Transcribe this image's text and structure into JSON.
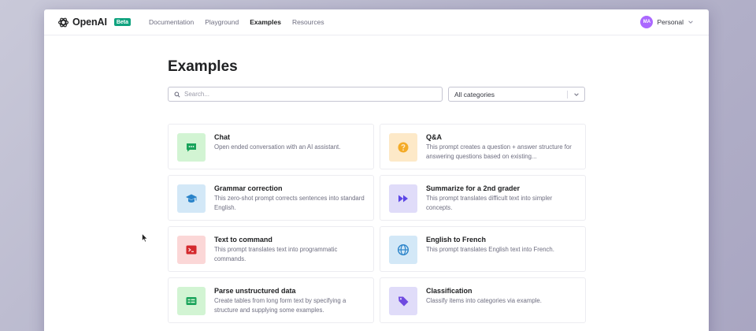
{
  "brand": {
    "name": "OpenAI",
    "badge": "Beta"
  },
  "nav": {
    "links": [
      {
        "label": "Documentation",
        "active": false
      },
      {
        "label": "Playground",
        "active": false
      },
      {
        "label": "Examples",
        "active": true
      },
      {
        "label": "Resources",
        "active": false
      }
    ]
  },
  "account": {
    "initials": "MA",
    "name": "Personal",
    "avatar_color": "#ab68ff"
  },
  "page": {
    "title": "Examples"
  },
  "search": {
    "placeholder": "Search...",
    "value": "",
    "icon": "search-icon"
  },
  "category_select": {
    "selected": "All categories",
    "icon": "chevron-down-icon"
  },
  "examples": [
    {
      "title": "Chat",
      "description": "Open ended conversation with an AI assistant.",
      "icon": "chat-icon",
      "bg": "#d2f4d3",
      "fg": "#19a35a"
    },
    {
      "title": "Q&A",
      "description": "This prompt creates a question + answer structure for answering questions based on existing...",
      "icon": "question-icon",
      "bg": "#fde9c8",
      "fg": "#f4ab27"
    },
    {
      "title": "Grammar correction",
      "description": "This zero-shot prompt corrects sentences into standard English.",
      "icon": "graduation-cap-icon",
      "bg": "#d3e8f7",
      "fg": "#2a83c9"
    },
    {
      "title": "Summarize for a 2nd grader",
      "description": "This prompt translates difficult text into simpler concepts.",
      "icon": "fast-forward-icon",
      "bg": "#e0dcf9",
      "fg": "#5c46e6"
    },
    {
      "title": "Text to command",
      "description": "This prompt translates text into programmatic commands.",
      "icon": "terminal-icon",
      "bg": "#fbd7d7",
      "fg": "#d4292d"
    },
    {
      "title": "English to French",
      "description": "This prompt translates English text into French.",
      "icon": "globe-icon",
      "bg": "#d3e8f7",
      "fg": "#2a83c9"
    },
    {
      "title": "Parse unstructured data",
      "description": "Create tables from long form text by specifying a structure and supplying some examples.",
      "icon": "table-icon",
      "bg": "#d2f4d3",
      "fg": "#19a35a"
    },
    {
      "title": "Classification",
      "description": "Classify items into categories via example.",
      "icon": "tag-icon",
      "bg": "#e0dcf9",
      "fg": "#6f4ae0"
    }
  ]
}
